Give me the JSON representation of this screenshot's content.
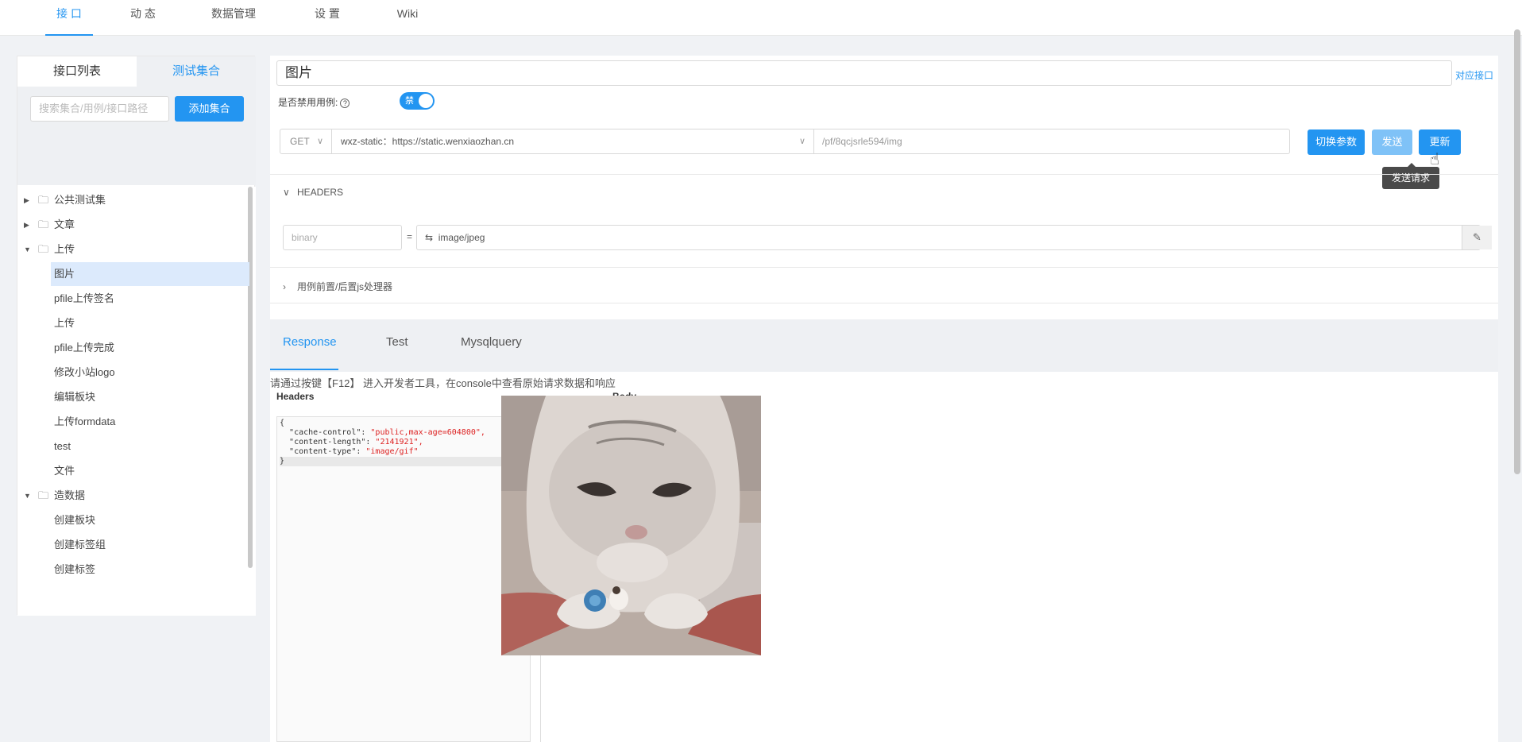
{
  "nav": {
    "tabs": [
      "接 口",
      "动 态",
      "数据管理",
      "设 置",
      "Wiki"
    ]
  },
  "left": {
    "tabs": [
      "接口列表",
      "测试集合"
    ],
    "search_placeholder": "搜索集合/用例/接口路径",
    "add_label": "添加集合",
    "tree": [
      {
        "label": "公共测试集",
        "kind": "folder",
        "expanded": false
      },
      {
        "label": "文章",
        "kind": "folder",
        "expanded": false
      },
      {
        "label": "上传",
        "kind": "folder",
        "expanded": true
      },
      {
        "label": "图片",
        "kind": "leaf",
        "selected": true
      },
      {
        "label": "pfile上传签名",
        "kind": "leaf"
      },
      {
        "label": "上传",
        "kind": "leaf"
      },
      {
        "label": "pfile上传完成",
        "kind": "leaf"
      },
      {
        "label": "修改小站logo",
        "kind": "leaf"
      },
      {
        "label": "编辑板块",
        "kind": "leaf"
      },
      {
        "label": "上传formdata",
        "kind": "leaf"
      },
      {
        "label": "test",
        "kind": "leaf"
      },
      {
        "label": "文件",
        "kind": "leaf"
      },
      {
        "label": "造数据",
        "kind": "folder",
        "expanded": true
      },
      {
        "label": "创建板块",
        "kind": "leaf"
      },
      {
        "label": "创建标签组",
        "kind": "leaf"
      },
      {
        "label": "创建标签",
        "kind": "leaf"
      }
    ]
  },
  "main": {
    "case_name": "图片",
    "related_link": "对应接口",
    "disable_label": "是否禁用用例:",
    "toggle_text": "禁",
    "method": "GET",
    "env": "wxz-static：https://static.wenxiaozhan.cn",
    "path": "/pf/8qcjsrle594/img",
    "buttons": {
      "switch": "切换参数",
      "send": "发送",
      "update": "更新"
    },
    "tooltip": "发送请求",
    "headers_section": "HEADERS",
    "header_key": "binary",
    "header_value": "image/jpeg",
    "script_section": "用例前置/后置js处理器"
  },
  "response": {
    "tabs": [
      "Response",
      "Test",
      "Mysqlquery"
    ],
    "hint": "请通过按键【F12】 进入开发者工具，在console中查看原始请求数据和响应",
    "headers_title": "Headers",
    "body_title": "Body",
    "json_lines": [
      {
        "key": "\"cache-control\"",
        "val": "\"public,max-age=604800\","
      },
      {
        "key": "\"content-length\"",
        "val": "\"2141921\","
      },
      {
        "key": "\"content-type\"",
        "val": "\"image/gif\""
      }
    ]
  },
  "colors": {
    "accent": "#2395f1"
  }
}
